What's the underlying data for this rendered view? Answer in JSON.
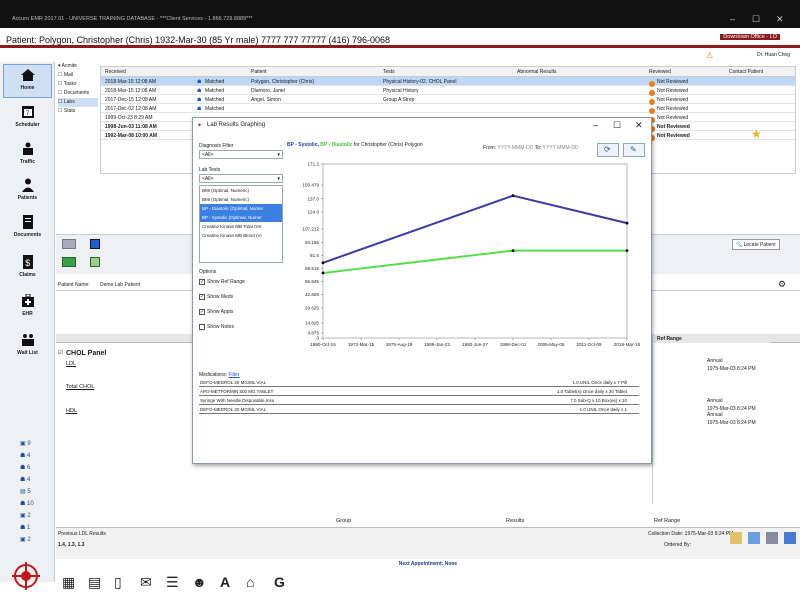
{
  "app": {
    "title": "Accuro EMR 2017.01 - UNIVERSE TRAINING DATABASE - ***Client Services - 1.866.729.8889***",
    "patient": "Patient: Polygon, Christopher (Chris) 1932-Mar-30 (85 Yr male) 7777 777 77777 (416) 796-0068",
    "office": "Downtown Office - LO",
    "user": "Dr. Huan Chng"
  },
  "sidebar": [
    {
      "label": "Home"
    },
    {
      "label": "Scheduler"
    },
    {
      "label": "Traffic"
    },
    {
      "label": "Patients"
    },
    {
      "label": "Documents"
    },
    {
      "label": "Claims"
    },
    {
      "label": "EHR"
    },
    {
      "label": "Wait List"
    }
  ],
  "sidebar_counts": [
    "9",
    "4",
    "6",
    "4",
    "5",
    "10",
    "2",
    "1",
    "2"
  ],
  "tree": [
    "Acmite",
    "Mail",
    "Tasks",
    "Documents",
    "Labs",
    "Stats"
  ],
  "labs_table": {
    "headers": [
      "Received",
      "Patient",
      "Tests",
      "Abnormal Results",
      "Reviewed",
      "Contact Patient"
    ],
    "rows": [
      {
        "received": "2018-Mar-15 12:08 AM",
        "status": "Matched",
        "patient": "Polygon, Christopher (Chris)",
        "tests": "Physical History-02, CHOL Panel",
        "reviewed": "Not Reviewed",
        "selected": true
      },
      {
        "received": "2018-Mar-15 12:08 AM",
        "status": "Matched",
        "patient": "Dlamoro, Janet",
        "tests": "Physical History",
        "reviewed": "Not Reviewed"
      },
      {
        "received": "2017-Dec-15 12:08 AM",
        "status": "Matched",
        "patient": "Angel, Simon",
        "tests": "Group A Strep",
        "reviewed": "Not Reviewed"
      },
      {
        "received": "2017-Dec-02 12:08 AM",
        "status": "Matched",
        "patient": "",
        "tests": "",
        "reviewed": "Not Reviewed"
      },
      {
        "received": "1999-Oct-23 8:29 AM",
        "status": "",
        "patient": "",
        "tests": "",
        "reviewed": "Not Reviewed"
      },
      {
        "received": "1998-Jun-03 11:08 AM",
        "status": "",
        "patient": "",
        "tests": "",
        "reviewed": "Not Reviewed",
        "bold": true
      },
      {
        "received": "1992-Mar-08 10:00 AM",
        "status": "",
        "patient": "",
        "tests": "",
        "reviewed": "Not Reviewed",
        "bold": true
      }
    ]
  },
  "lower": {
    "locate_button": "Locate Patient",
    "patient_name_label": "Patient Name:",
    "patient_name_value": "Demo Lab Patient",
    "panel_title": "CHOL Panel",
    "tests": [
      "LDL",
      "Total CHOL",
      "HDL"
    ],
    "ref_range_header": "Ref Range",
    "ref_entries": [
      {
        "flag": "Annual",
        "date": "1975-Mar-03 8:24 PM"
      },
      {
        "flag": "Annual",
        "date": "1975-Mar-03 8:24 PM"
      },
      {
        "flag": "Annual",
        "date": "1975-Mar-03 8:24 PM"
      }
    ],
    "prev_label": "Previous LDL Results",
    "prev_values": "1.4, 1.3, 1.3",
    "collection_date": "Collection Date: 1975-Mar-03 8:24 PM",
    "ordered_by": "Ordered By:",
    "next_appt": "Next Appointment: None",
    "col_group": "Group",
    "col_results": "Results",
    "col_ref": "Ref Range"
  },
  "modal": {
    "title": "Lab Results Graphing",
    "diagnosis_label": "Diagnosis Filter",
    "diagnosis_value": "<All>",
    "labtests_label": "Lab Tests",
    "labtests_value": "<All>",
    "labtests_list": [
      "BMI (Optimal, Numeric)",
      "BMI (Optimal, Numeric)",
      "BP - Diastolic (Optimal, Numer",
      "BP - Systolic (Optimal, Numer",
      "Creatine Kinase MB Total Ore",
      "Creatine Kinase MB Blood (Vi"
    ],
    "options_label": "Options",
    "options": [
      {
        "label": "Show Ref Range",
        "checked": true
      },
      {
        "label": "Show Meds",
        "checked": true
      },
      {
        "label": "Show Appts",
        "checked": true
      },
      {
        "label": "Show Notes",
        "checked": false
      }
    ],
    "chart_header_sys": "BP - Systolic,",
    "chart_header_dia": "BP - Diastolic",
    "chart_header_for": "for Christopher (Chris) Polygon",
    "from_label": "From:",
    "from_value": "YYYY-MMM-DD",
    "to_label": "To:",
    "to_value": "YYYY-MMM-DD",
    "medications_label": "Medications:",
    "medications_filter": "Filter",
    "medications": [
      {
        "name": "DEFO-MEDROL 20 MG/ML VIAL",
        "dose": "1.0 UNIL Once daily x 7 Pill"
      },
      {
        "name": "APO-METFORMIN 500 MG TABLET",
        "dose": "1.0 Tablet(s) Once daily x 30 Tablet"
      },
      {
        "name": "Syringe With Needle,Disposable,Insu",
        "dose": "7.0 Sub-Q x 10 Box(es) x 10"
      },
      {
        "name": "DEFO-MEDROL 20 MG/ML VIAL",
        "dose": "1.0 UNIL Once daily x 1"
      }
    ]
  },
  "chart_data": {
    "type": "line",
    "x": [
      "1990-Oct-15",
      "1973-Mar-15",
      "1979-Aug-19",
      "1986-Jan-22",
      "1992-Jun-27",
      "1998-Dec-01",
      "2005-May-06",
      "2011-Oct-09",
      "2018-Mar-16"
    ],
    "ylim": [
      0,
      171.2
    ],
    "yticks": [
      0,
      4.875,
      14.825,
      29.625,
      42.825,
      55.645,
      68.515,
      81.5,
      94.155,
      107.212,
      124.0,
      137.0,
      150.479,
      171.2
    ],
    "ytick_labels": [
      "0",
      "4.875",
      "14.825",
      "29.625",
      "42.825",
      "55.645",
      "68.515",
      "81.5",
      "94.155",
      "107.212",
      "124.0",
      "137.0",
      "150.479",
      "171.2"
    ],
    "series": [
      {
        "name": "BP - Systolic",
        "color": "#3a3aa8",
        "points": [
          [
            "1990-Oct-15",
            74
          ],
          [
            "1998-Dec-01",
            140
          ],
          [
            "2018-Mar-16",
            113
          ]
        ]
      },
      {
        "name": "BP - Diastolic",
        "color": "#55e04a",
        "points": [
          [
            "1990-Oct-15",
            64
          ],
          [
            "1998-Dec-01",
            86
          ],
          [
            "2018-Mar-16",
            86
          ]
        ]
      }
    ]
  }
}
